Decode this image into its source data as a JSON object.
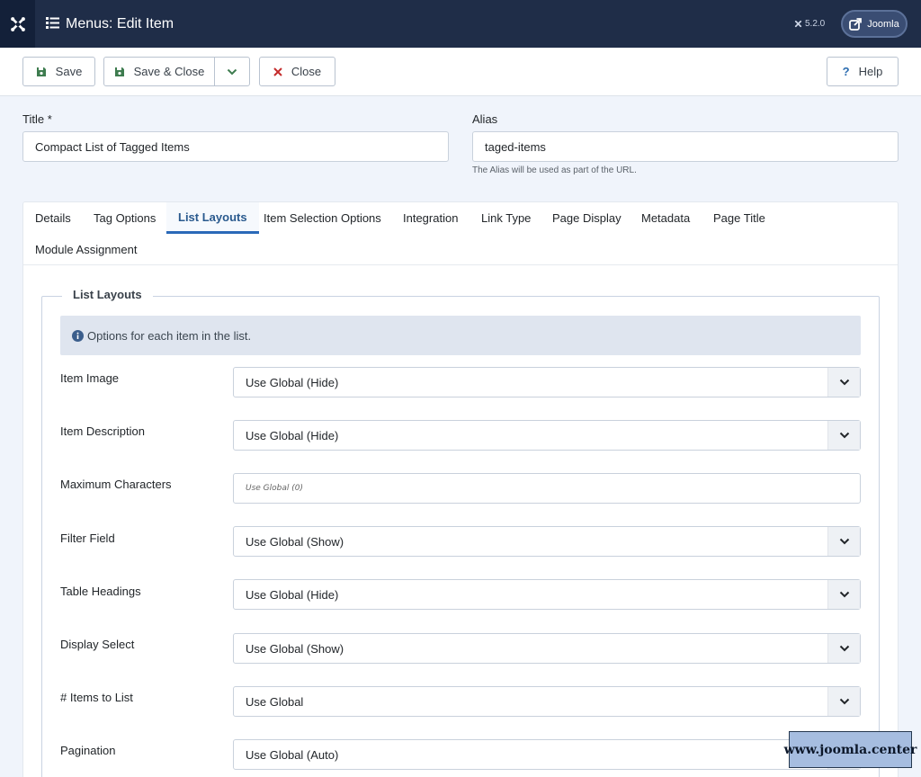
{
  "header": {
    "title": "Menus: Edit Item",
    "version": "5.2.0",
    "site_link": "Joomla"
  },
  "toolbar": {
    "save_label": "Save",
    "save_close_label": "Save & Close",
    "close_label": "Close",
    "help_label": "Help"
  },
  "form": {
    "title_label": "Title *",
    "title_value": "Compact List of Tagged Items",
    "alias_label": "Alias",
    "alias_value": "taged-items",
    "alias_hint": "The Alias will be used as part of the URL."
  },
  "tabs": [
    {
      "label": "Details"
    },
    {
      "label": "Tag Options"
    },
    {
      "label": "List Layouts",
      "active": true
    },
    {
      "label": "Item Selection Options"
    },
    {
      "label": "Integration"
    },
    {
      "label": "Link Type"
    },
    {
      "label": "Page Display"
    },
    {
      "label": "Metadata"
    },
    {
      "label": "Page Title"
    },
    {
      "label": "Module Assignment"
    }
  ],
  "panel": {
    "legend": "List Layouts",
    "info": "Options for each item in the list.",
    "fields": [
      {
        "label": "Item Image",
        "type": "select",
        "value": "Use Global (Hide)"
      },
      {
        "label": "Item Description",
        "type": "select",
        "value": "Use Global (Hide)"
      },
      {
        "label": "Maximum Characters",
        "type": "number",
        "placeholder": "Use Global (0)"
      },
      {
        "label": "Filter Field",
        "type": "select",
        "value": "Use Global (Show)"
      },
      {
        "label": "Table Headings",
        "type": "select",
        "value": "Use Global (Hide)"
      },
      {
        "label": "Display Select",
        "type": "select",
        "value": "Use Global (Show)"
      },
      {
        "label": "# Items to List",
        "type": "select",
        "value": "Use Global"
      },
      {
        "label": "Pagination",
        "type": "select",
        "value": "Use Global (Auto)"
      }
    ]
  },
  "watermark": "www.joomla.center",
  "colors": {
    "header_bg": "#1f2d48",
    "accent": "#2a69b8",
    "save_icon": "#3e7c4f",
    "close_icon": "#c42c2c"
  }
}
